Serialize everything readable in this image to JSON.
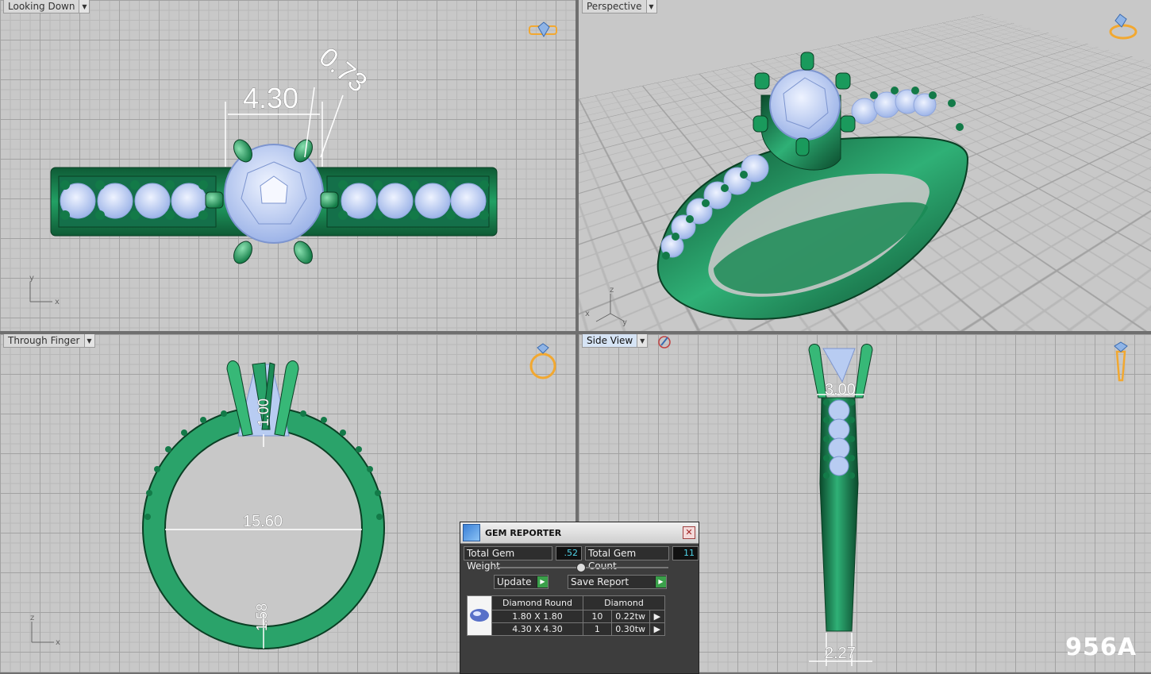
{
  "viewports": {
    "top": {
      "label": "Looking Down",
      "axis_v": "y",
      "axis_h": "x"
    },
    "perspective": {
      "label": "Perspective",
      "axis_v": "z",
      "axis_h": "y",
      "axis_x": "x"
    },
    "front": {
      "label": "Through Finger",
      "axis_v": "z",
      "axis_h": "x"
    },
    "side": {
      "label": "Side View"
    }
  },
  "dimensions": {
    "top_width": "4.30",
    "top_diag": "0.73",
    "front_height": "1.00",
    "front_diameter": "15.60",
    "front_shank": "1.58",
    "side_top": "3.00",
    "side_bottom": "2.27"
  },
  "gem_reporter": {
    "title": "GEM REPORTER",
    "total_weight_label": "Total Gem Weight",
    "total_weight_value": ".52",
    "total_count_label": "Total Gem Count",
    "total_count_value": "11",
    "update_label": "Update",
    "save_label": "Save Report",
    "table_header": [
      "Diamond Round",
      "Diamond"
    ],
    "rows": [
      {
        "size": "1.80 X 1.80",
        "count": "10",
        "weight": "0.22tw"
      },
      {
        "size": "4.30 X 4.30",
        "count": "1",
        "weight": "0.30tw"
      }
    ]
  },
  "watermark": "956A",
  "colors": {
    "metal": "#1f9a5e",
    "metal_dark": "#0d5a34",
    "gem": "#b8ccf2",
    "accent": "#f2a830"
  }
}
